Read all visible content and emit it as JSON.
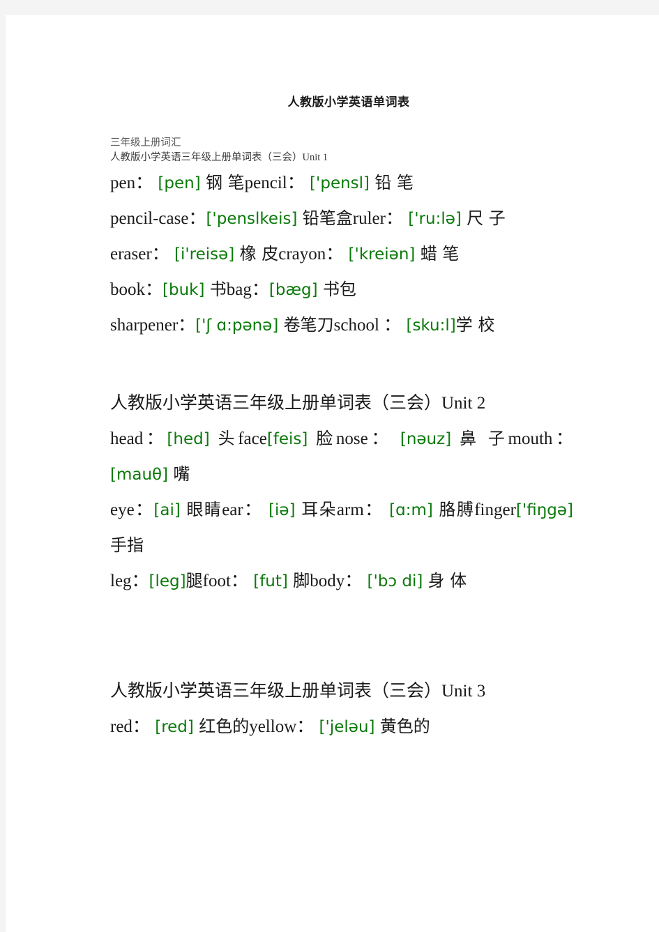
{
  "document": {
    "title": "人教版小学英语单词表",
    "subheadings": [
      "三年级上册词汇",
      "人教版小学英语三年级上册单词表（三会）Unit 1"
    ],
    "accent_color": "#0b7a0b",
    "text_color": "#1a1a1a",
    "page_background": "#ffffff",
    "canvas_background": "#f4f4f4"
  },
  "sections": [
    {
      "id": "unit1",
      "heading": null,
      "lines": [
        {
          "id": "u1-l1",
          "entries": [
            {
              "word": "pen",
              "sep": "：",
              "phonetic": "[pen]",
              "meaning": "钢 笔"
            },
            {
              "word": "pencil",
              "sep": "：",
              "phonetic": "['pensl]",
              "meaning": "铅 笔"
            }
          ]
        },
        {
          "id": "u1-l2",
          "entries": [
            {
              "word": "pencil-case",
              "sep": "：",
              "phonetic": "['penslkeis]",
              "meaning": "铅笔盒"
            },
            {
              "word": "ruler",
              "sep": "：",
              "phonetic": "['ru:lə]",
              "meaning": "尺 子"
            }
          ]
        },
        {
          "id": "u1-l3",
          "entries": [
            {
              "word": "eraser",
              "sep": "：",
              "phonetic": "[i'reisə]",
              "meaning": "橡 皮"
            },
            {
              "word": "crayon",
              "sep": "：",
              "phonetic": "['kreiən]",
              "meaning": "蜡 笔"
            }
          ]
        },
        {
          "id": "u1-l4",
          "entries": [
            {
              "word": "book",
              "sep": "：",
              "phonetic": "[buk]",
              "meaning": "书"
            },
            {
              "word": "bag",
              "sep": "：",
              "phonetic": "[bæg]",
              "meaning": "书包"
            }
          ]
        },
        {
          "id": "u1-l5",
          "entries": [
            {
              "word": "sharpener",
              "sep": "：",
              "phonetic": "['ʃ ɑ:pənə]",
              "meaning": "卷笔刀"
            },
            {
              "word": "school",
              "sep": " ：",
              "phonetic": "[sku:l]",
              "meaning": "学 校"
            }
          ]
        }
      ]
    },
    {
      "id": "unit2",
      "heading": "人教版小学英语三年级上册单词表（三会）Unit 2",
      "lines": [
        {
          "id": "u2-l1",
          "entries": [
            {
              "word": "head",
              "sep": "：",
              "phonetic": "[hed]",
              "meaning": "头"
            },
            {
              "word": "face",
              "sep": "",
              "phonetic": "[feis]",
              "meaning": "脸"
            },
            {
              "word": "nose",
              "sep": "：",
              "phonetic": "[nəuz]",
              "meaning": "鼻 子"
            },
            {
              "word": "mouth",
              "sep": "：",
              "phonetic": "[mauθ]",
              "meaning": "嘴"
            }
          ]
        },
        {
          "id": "u2-l2",
          "entries": [
            {
              "word": "eye",
              "sep": "：",
              "phonetic": "[ai]",
              "meaning": "眼睛"
            },
            {
              "word": "ear",
              "sep": "：",
              "phonetic": "[iə]",
              "meaning": "耳朵"
            },
            {
              "word": "arm",
              "sep": "：",
              "phonetic": "[ɑ:m]",
              "meaning": "胳膊"
            },
            {
              "word": "finger",
              "sep": "",
              "phonetic": "['fiŋgə]",
              "meaning": "手指"
            }
          ]
        },
        {
          "id": "u2-l3",
          "entries": [
            {
              "word": "leg",
              "sep": "：",
              "phonetic": "[leg]",
              "meaning": "腿"
            },
            {
              "word": "foot",
              "sep": "：",
              "phonetic": "[fut]",
              "meaning": "脚"
            },
            {
              "word": "body",
              "sep": "：",
              "phonetic": "['bɔ di]",
              "meaning": "身 体"
            }
          ]
        }
      ]
    },
    {
      "id": "unit3",
      "heading": "人教版小学英语三年级上册单词表（三会）Unit 3",
      "lines": [
        {
          "id": "u3-l1",
          "entries": [
            {
              "word": "red",
              "sep": "：",
              "phonetic": "[red]",
              "meaning": "红色的"
            },
            {
              "word": "yellow",
              "sep": "：",
              "phonetic": "['jeləu]",
              "meaning": "黄色的"
            }
          ]
        }
      ]
    }
  ],
  "lines_rendered": {
    "u1_l1": [
      {
        "t": "en",
        "v": "pen："
      },
      {
        "t": "ph",
        "v": " [pen] "
      },
      {
        "t": "cn",
        "v": "钢 笔"
      },
      {
        "t": "sp",
        "v": "          "
      },
      {
        "t": "en",
        "v": "pencil："
      },
      {
        "t": "ph",
        "v": " ['pensl] "
      },
      {
        "t": "cn",
        "v": "铅 笔"
      }
    ],
    "u1_l2": [
      {
        "t": "en",
        "v": "pencil-case："
      },
      {
        "t": "ph",
        "v": "['penslkeis] "
      },
      {
        "t": "cn",
        "v": "铅笔盒"
      },
      {
        "t": "sp",
        "v": "  "
      },
      {
        "t": "en",
        "v": "ruler："
      },
      {
        "t": "ph",
        "v": " ['ru:lə] "
      },
      {
        "t": "cn",
        "v": "尺 子"
      }
    ],
    "u1_l3": [
      {
        "t": "en",
        "v": "eraser："
      },
      {
        "t": "ph",
        "v": " [i'reisə] "
      },
      {
        "t": "cn",
        "v": "橡 皮"
      },
      {
        "t": "sp",
        "v": "      "
      },
      {
        "t": "en",
        "v": "crayon："
      },
      {
        "t": "ph",
        "v": " ['kreiən] "
      },
      {
        "t": "cn",
        "v": "蜡 笔"
      }
    ],
    "u1_l4": [
      {
        "t": "en",
        "v": "book："
      },
      {
        "t": "ph",
        "v": "[buk] "
      },
      {
        "t": "cn",
        "v": "书"
      },
      {
        "t": "sp",
        "v": "                "
      },
      {
        "t": "en",
        "v": "bag："
      },
      {
        "t": "ph",
        "v": "[bæg] "
      },
      {
        "t": "cn",
        "v": "书包"
      }
    ],
    "u1_l5": [
      {
        "t": "en",
        "v": "sharpener："
      },
      {
        "t": "ph",
        "v": "['ʃ ɑ:pənə] "
      },
      {
        "t": "cn",
        "v": "卷笔刀"
      },
      {
        "t": "sp",
        "v": "    "
      },
      {
        "t": "en",
        "v": "school ："
      },
      {
        "t": "ph",
        "v": " [sku:l]"
      },
      {
        "t": "cn",
        "v": "学 校"
      }
    ],
    "u2_l1": [
      {
        "t": "en",
        "v": "head："
      },
      {
        "t": "ph",
        "v": "[hed] "
      },
      {
        "t": "cn",
        "v": "头"
      },
      {
        "t": "sp",
        "v": "     "
      },
      {
        "t": "en",
        "v": "face"
      },
      {
        "t": "ph",
        "v": "[feis] "
      },
      {
        "t": "cn",
        "v": "脸"
      },
      {
        "t": "sp",
        "v": "   "
      },
      {
        "t": "en",
        "v": "nose："
      },
      {
        "t": "ph",
        "v": " [nəuz] "
      },
      {
        "t": "cn",
        "v": "鼻 子"
      },
      {
        "t": "sp",
        "v": "   "
      },
      {
        "t": "en",
        "v": "mouth："
      },
      {
        "t": "ph",
        "v": " [mauθ] "
      },
      {
        "t": "cn",
        "v": "嘴"
      }
    ],
    "u2_l2": [
      {
        "t": "en",
        "v": "eye："
      },
      {
        "t": "ph",
        "v": "[ai] "
      },
      {
        "t": "cn",
        "v": "眼睛"
      },
      {
        "t": "sp",
        "v": "       "
      },
      {
        "t": "en",
        "v": "ear："
      },
      {
        "t": "ph",
        "v": " [iə] "
      },
      {
        "t": "cn",
        "v": "耳朵"
      },
      {
        "t": "sp",
        "v": "  "
      },
      {
        "t": "en",
        "v": "arm："
      },
      {
        "t": "ph",
        "v": " [ɑ:m] "
      },
      {
        "t": "cn",
        "v": "胳膊"
      },
      {
        "t": "sp",
        "v": " "
      },
      {
        "t": "en",
        "v": "finger"
      },
      {
        "t": "ph",
        "v": "['fiŋgə] "
      },
      {
        "t": "cn",
        "v": "手指"
      }
    ],
    "u2_l3": [
      {
        "t": "en",
        "v": "leg："
      },
      {
        "t": "ph",
        "v": "[leg]"
      },
      {
        "t": "cn",
        "v": "腿"
      },
      {
        "t": "sp",
        "v": "            "
      },
      {
        "t": "en",
        "v": "foot："
      },
      {
        "t": "ph",
        "v": " [fut] "
      },
      {
        "t": "cn",
        "v": "脚"
      },
      {
        "t": "sp",
        "v": "  "
      },
      {
        "t": "en",
        "v": "body："
      },
      {
        "t": "ph",
        "v": " ['bɔ di] "
      },
      {
        "t": "cn",
        "v": "身 体"
      }
    ],
    "u3_l1": [
      {
        "t": "en",
        "v": "red："
      },
      {
        "t": "ph",
        "v": " [red] "
      },
      {
        "t": "cn",
        "v": "红色的"
      },
      {
        "t": "sp",
        "v": "             "
      },
      {
        "t": "en",
        "v": "yellow："
      },
      {
        "t": "ph",
        "v": " ['jeləu] "
      },
      {
        "t": "cn",
        "v": "黄色的"
      }
    ]
  }
}
